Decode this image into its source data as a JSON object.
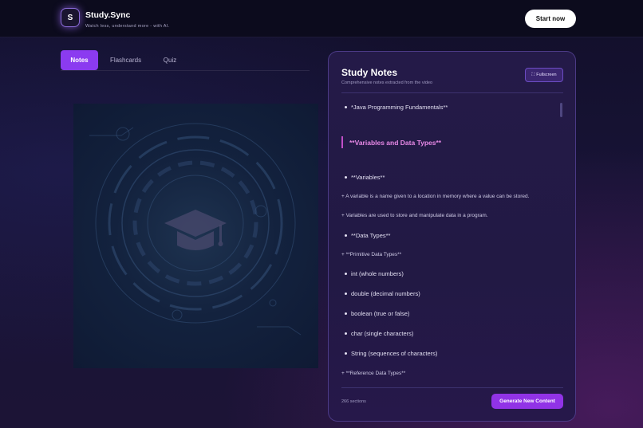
{
  "header": {
    "logo_letter": "S",
    "brand": "Study.Sync",
    "tagline": "Watch less, understand more - with AI.",
    "start_label": "Start now"
  },
  "tabs": [
    {
      "label": "Notes",
      "active": true
    },
    {
      "label": "Flashcards",
      "active": false
    },
    {
      "label": "Quiz",
      "active": false
    }
  ],
  "video": {
    "icon": "graduation-cap-icon"
  },
  "notes_panel": {
    "title": "Study Notes",
    "subtitle": "Comprehensive notes extracted from the video",
    "fullscreen_label": "Fullscreen",
    "lines": [
      {
        "kind": "bullet",
        "text": "*Java Programming Fundamentals**"
      },
      {
        "kind": "heading",
        "text": "**Variables and Data Types**"
      },
      {
        "kind": "bullet",
        "text": "**Variables**"
      },
      {
        "kind": "plus",
        "text": "+ A variable is a name given to a location in memory where a value can be stored."
      },
      {
        "kind": "plus",
        "text": "+ Variables are used to store and manipulate data in a program."
      },
      {
        "kind": "bullet",
        "text": "**Data Types**"
      },
      {
        "kind": "plus",
        "text": "+ **Primitive Data Types**"
      },
      {
        "kind": "bullet",
        "text": "int (whole numbers)"
      },
      {
        "kind": "bullet",
        "text": "double (decimal numbers)"
      },
      {
        "kind": "bullet",
        "text": "boolean (true or false)"
      },
      {
        "kind": "bullet",
        "text": "char (single characters)"
      },
      {
        "kind": "bullet",
        "text": "String (sequences of characters)"
      },
      {
        "kind": "plus",
        "text": "+ **Reference Data Types**"
      }
    ],
    "sections_count": "266 sections",
    "generate_label": "Generate New Content"
  },
  "colors": {
    "accent": "#8b3bf0",
    "heading": "#e789e6",
    "panel_bg": "#241a48"
  }
}
